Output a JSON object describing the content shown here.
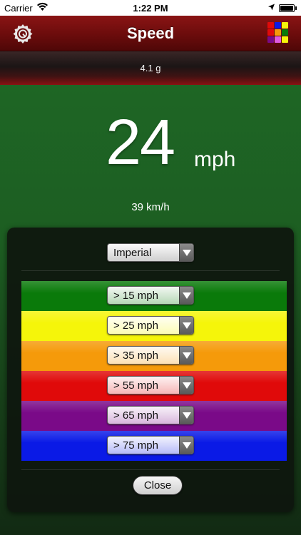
{
  "status_bar": {
    "carrier": "Carrier",
    "time": "1:22 PM",
    "icons": [
      "wifi-icon",
      "location-arrow-icon",
      "battery-icon"
    ]
  },
  "nav": {
    "title": "Speed",
    "left_icon": "gear-icon",
    "right_icon": "color-grid-icon"
  },
  "g_force": "4.1 g",
  "speed": {
    "value": "24",
    "unit": "mph",
    "alternate": "39 km/h"
  },
  "panel": {
    "units_select": "Imperial",
    "thresholds": [
      {
        "label": "> 15 mph",
        "color": "#0a7a0a"
      },
      {
        "label": "> 25 mph",
        "color": "#f5f50a"
      },
      {
        "label": "> 35 mph",
        "color": "#f59a0a"
      },
      {
        "label": "> 55 mph",
        "color": "#e00a0a"
      },
      {
        "label": "> 65 mph",
        "color": "#7a0a88"
      },
      {
        "label": "> 75 mph",
        "color": "#0a1ae6"
      }
    ],
    "close_label": "Close"
  },
  "colors": {
    "nav_red": "#6b0c0c",
    "background_green": "#1e6a26"
  }
}
